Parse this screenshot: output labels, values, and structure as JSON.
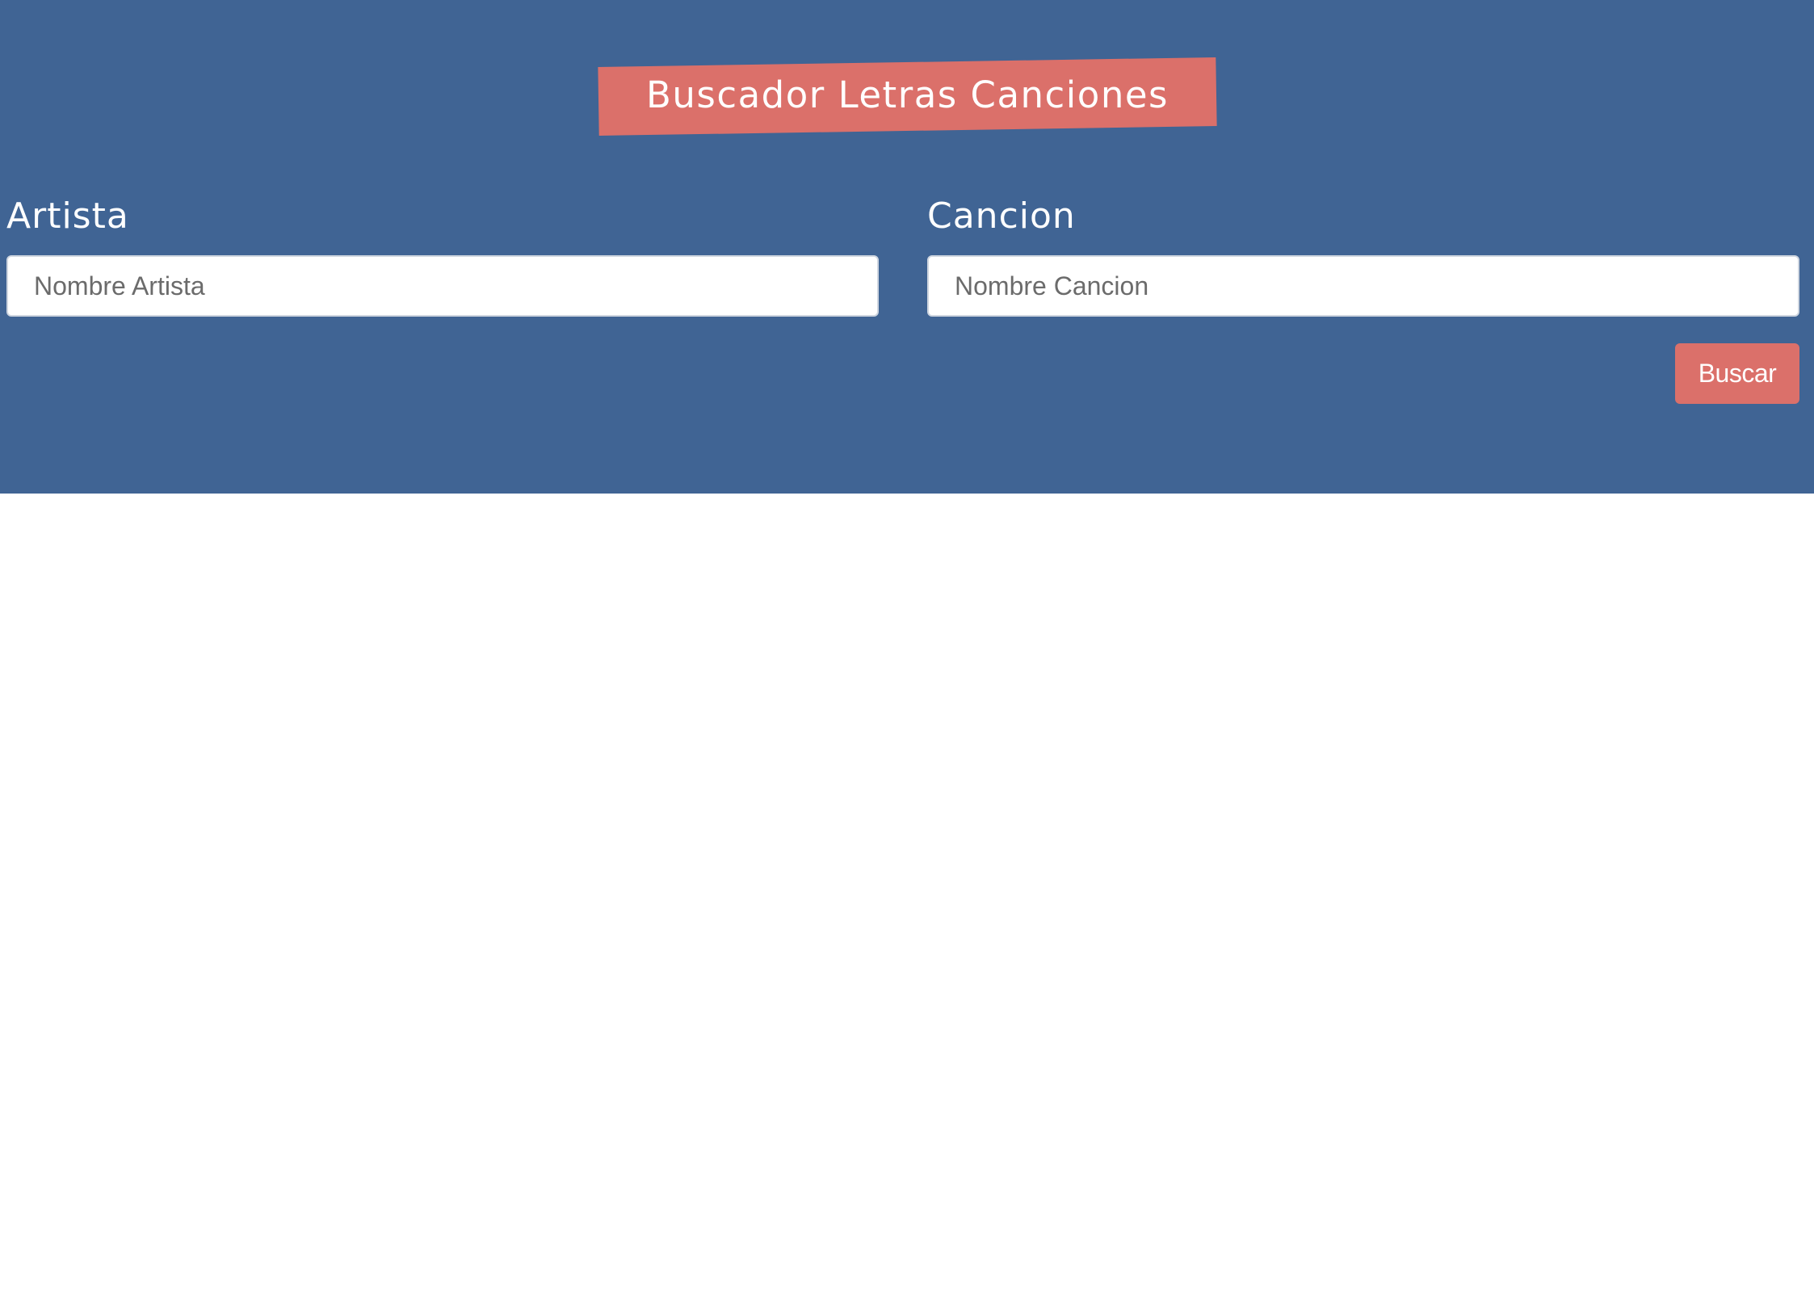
{
  "header": {
    "title": "Buscador Letras Canciones"
  },
  "form": {
    "artist": {
      "label": "Artista",
      "placeholder": "Nombre Artista",
      "value": ""
    },
    "song": {
      "label": "Cancion",
      "placeholder": "Nombre Cancion",
      "value": ""
    },
    "submit_label": "Buscar"
  },
  "colors": {
    "hero_background": "#406494",
    "accent": "#db706a",
    "page_background": "#ffffff",
    "label_text": "#ffffff",
    "placeholder_text": "#6b6b6b"
  }
}
